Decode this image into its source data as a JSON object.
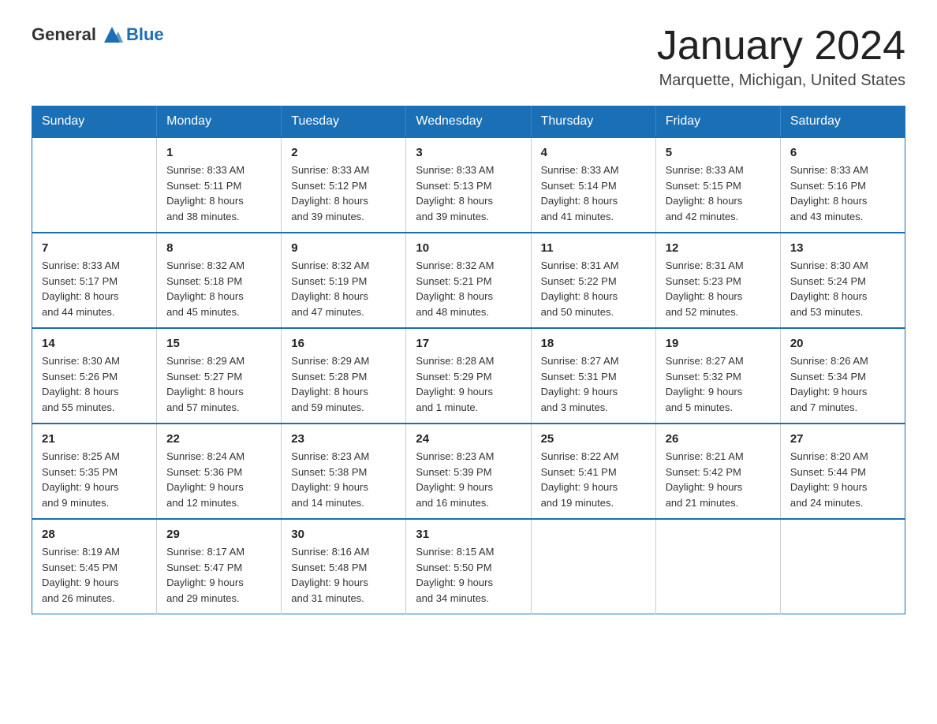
{
  "header": {
    "logo_general": "General",
    "logo_blue": "Blue",
    "month": "January 2024",
    "location": "Marquette, Michigan, United States"
  },
  "days_of_week": [
    "Sunday",
    "Monday",
    "Tuesday",
    "Wednesday",
    "Thursday",
    "Friday",
    "Saturday"
  ],
  "weeks": [
    [
      {
        "day": "",
        "info": ""
      },
      {
        "day": "1",
        "info": "Sunrise: 8:33 AM\nSunset: 5:11 PM\nDaylight: 8 hours\nand 38 minutes."
      },
      {
        "day": "2",
        "info": "Sunrise: 8:33 AM\nSunset: 5:12 PM\nDaylight: 8 hours\nand 39 minutes."
      },
      {
        "day": "3",
        "info": "Sunrise: 8:33 AM\nSunset: 5:13 PM\nDaylight: 8 hours\nand 39 minutes."
      },
      {
        "day": "4",
        "info": "Sunrise: 8:33 AM\nSunset: 5:14 PM\nDaylight: 8 hours\nand 41 minutes."
      },
      {
        "day": "5",
        "info": "Sunrise: 8:33 AM\nSunset: 5:15 PM\nDaylight: 8 hours\nand 42 minutes."
      },
      {
        "day": "6",
        "info": "Sunrise: 8:33 AM\nSunset: 5:16 PM\nDaylight: 8 hours\nand 43 minutes."
      }
    ],
    [
      {
        "day": "7",
        "info": "Sunrise: 8:33 AM\nSunset: 5:17 PM\nDaylight: 8 hours\nand 44 minutes."
      },
      {
        "day": "8",
        "info": "Sunrise: 8:32 AM\nSunset: 5:18 PM\nDaylight: 8 hours\nand 45 minutes."
      },
      {
        "day": "9",
        "info": "Sunrise: 8:32 AM\nSunset: 5:19 PM\nDaylight: 8 hours\nand 47 minutes."
      },
      {
        "day": "10",
        "info": "Sunrise: 8:32 AM\nSunset: 5:21 PM\nDaylight: 8 hours\nand 48 minutes."
      },
      {
        "day": "11",
        "info": "Sunrise: 8:31 AM\nSunset: 5:22 PM\nDaylight: 8 hours\nand 50 minutes."
      },
      {
        "day": "12",
        "info": "Sunrise: 8:31 AM\nSunset: 5:23 PM\nDaylight: 8 hours\nand 52 minutes."
      },
      {
        "day": "13",
        "info": "Sunrise: 8:30 AM\nSunset: 5:24 PM\nDaylight: 8 hours\nand 53 minutes."
      }
    ],
    [
      {
        "day": "14",
        "info": "Sunrise: 8:30 AM\nSunset: 5:26 PM\nDaylight: 8 hours\nand 55 minutes."
      },
      {
        "day": "15",
        "info": "Sunrise: 8:29 AM\nSunset: 5:27 PM\nDaylight: 8 hours\nand 57 minutes."
      },
      {
        "day": "16",
        "info": "Sunrise: 8:29 AM\nSunset: 5:28 PM\nDaylight: 8 hours\nand 59 minutes."
      },
      {
        "day": "17",
        "info": "Sunrise: 8:28 AM\nSunset: 5:29 PM\nDaylight: 9 hours\nand 1 minute."
      },
      {
        "day": "18",
        "info": "Sunrise: 8:27 AM\nSunset: 5:31 PM\nDaylight: 9 hours\nand 3 minutes."
      },
      {
        "day": "19",
        "info": "Sunrise: 8:27 AM\nSunset: 5:32 PM\nDaylight: 9 hours\nand 5 minutes."
      },
      {
        "day": "20",
        "info": "Sunrise: 8:26 AM\nSunset: 5:34 PM\nDaylight: 9 hours\nand 7 minutes."
      }
    ],
    [
      {
        "day": "21",
        "info": "Sunrise: 8:25 AM\nSunset: 5:35 PM\nDaylight: 9 hours\nand 9 minutes."
      },
      {
        "day": "22",
        "info": "Sunrise: 8:24 AM\nSunset: 5:36 PM\nDaylight: 9 hours\nand 12 minutes."
      },
      {
        "day": "23",
        "info": "Sunrise: 8:23 AM\nSunset: 5:38 PM\nDaylight: 9 hours\nand 14 minutes."
      },
      {
        "day": "24",
        "info": "Sunrise: 8:23 AM\nSunset: 5:39 PM\nDaylight: 9 hours\nand 16 minutes."
      },
      {
        "day": "25",
        "info": "Sunrise: 8:22 AM\nSunset: 5:41 PM\nDaylight: 9 hours\nand 19 minutes."
      },
      {
        "day": "26",
        "info": "Sunrise: 8:21 AM\nSunset: 5:42 PM\nDaylight: 9 hours\nand 21 minutes."
      },
      {
        "day": "27",
        "info": "Sunrise: 8:20 AM\nSunset: 5:44 PM\nDaylight: 9 hours\nand 24 minutes."
      }
    ],
    [
      {
        "day": "28",
        "info": "Sunrise: 8:19 AM\nSunset: 5:45 PM\nDaylight: 9 hours\nand 26 minutes."
      },
      {
        "day": "29",
        "info": "Sunrise: 8:17 AM\nSunset: 5:47 PM\nDaylight: 9 hours\nand 29 minutes."
      },
      {
        "day": "30",
        "info": "Sunrise: 8:16 AM\nSunset: 5:48 PM\nDaylight: 9 hours\nand 31 minutes."
      },
      {
        "day": "31",
        "info": "Sunrise: 8:15 AM\nSunset: 5:50 PM\nDaylight: 9 hours\nand 34 minutes."
      },
      {
        "day": "",
        "info": ""
      },
      {
        "day": "",
        "info": ""
      },
      {
        "day": "",
        "info": ""
      }
    ]
  ]
}
